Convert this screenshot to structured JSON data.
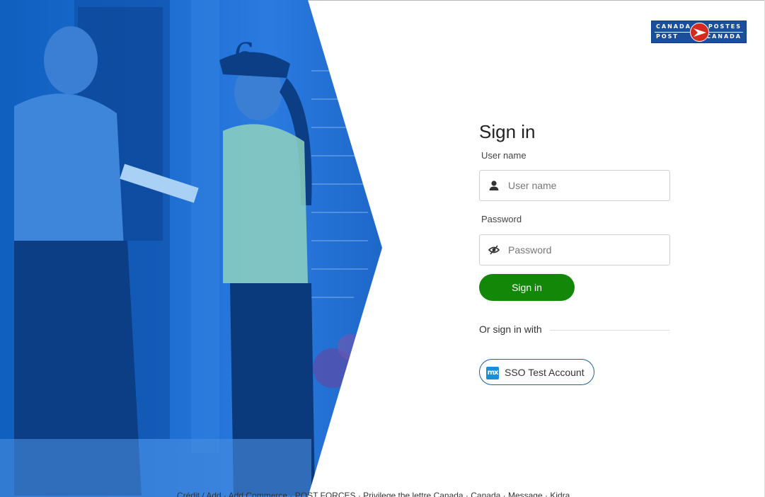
{
  "brand": {
    "logo_left_top": "CANADA",
    "logo_left_bottom": "POST",
    "logo_right_top": "POSTES",
    "logo_right_bottom": "CANADA"
  },
  "form": {
    "title": "Sign in",
    "username_label": "User name",
    "username_placeholder": "User name",
    "username_value": "",
    "password_label": "Password",
    "password_placeholder": "Password",
    "password_value": "",
    "signin_button": "Sign in",
    "or_sign_in_with": "Or sign in with",
    "sso_icon_text": "mx",
    "sso_button": "SSO Test Account"
  },
  "icons": {
    "user": "user-icon",
    "password": "eye-slash-icon",
    "sso": "mendix-icon"
  },
  "colors": {
    "accent_green": "#138808",
    "hero_blue": "#1f6fd3",
    "logo_blue": "#1b4f9c",
    "logo_red": "#d52b1e",
    "sso_border": "#1d5fa8"
  },
  "footer_strip": {
    "text": "Crédit / Add · Add Commerce · POST FORCES · Privilege the lettre Canada · Canada · Message · Kidra"
  }
}
